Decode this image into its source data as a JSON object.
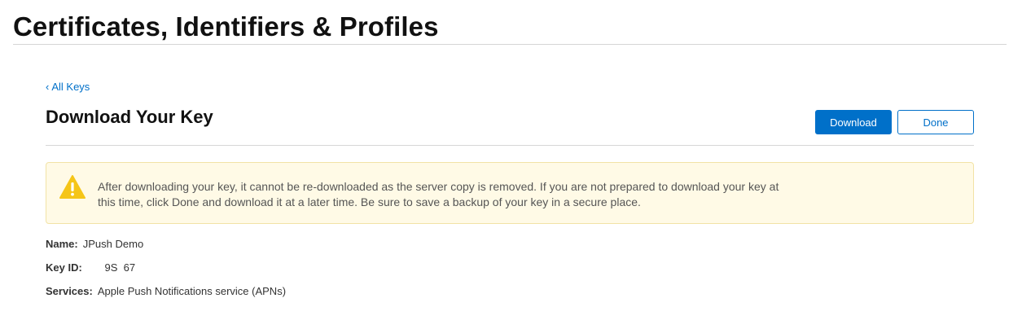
{
  "header": {
    "title": "Certificates, Identifiers & Profiles"
  },
  "nav": {
    "back_label": "All Keys"
  },
  "page": {
    "heading": "Download Your Key"
  },
  "actions": {
    "download_label": "Download",
    "done_label": "Done"
  },
  "warning": {
    "icon": "warning-triangle-icon",
    "text": "After downloading your key, it cannot be re-downloaded as the server copy is removed. If you are not prepared to download your key at this time, click Done and download it at a later time. Be sure to save a backup of your key in a secure place."
  },
  "details": {
    "name_label": "Name:",
    "name_value": "JPush Demo",
    "keyid_label": "Key ID:",
    "keyid_value": "      9S  67",
    "services_label": "Services:",
    "services_value": "Apple Push Notifications service (APNs)"
  },
  "colors": {
    "accent": "#0070c9",
    "warning_bg": "#fffae6",
    "warning_icon": "#f5c518"
  }
}
